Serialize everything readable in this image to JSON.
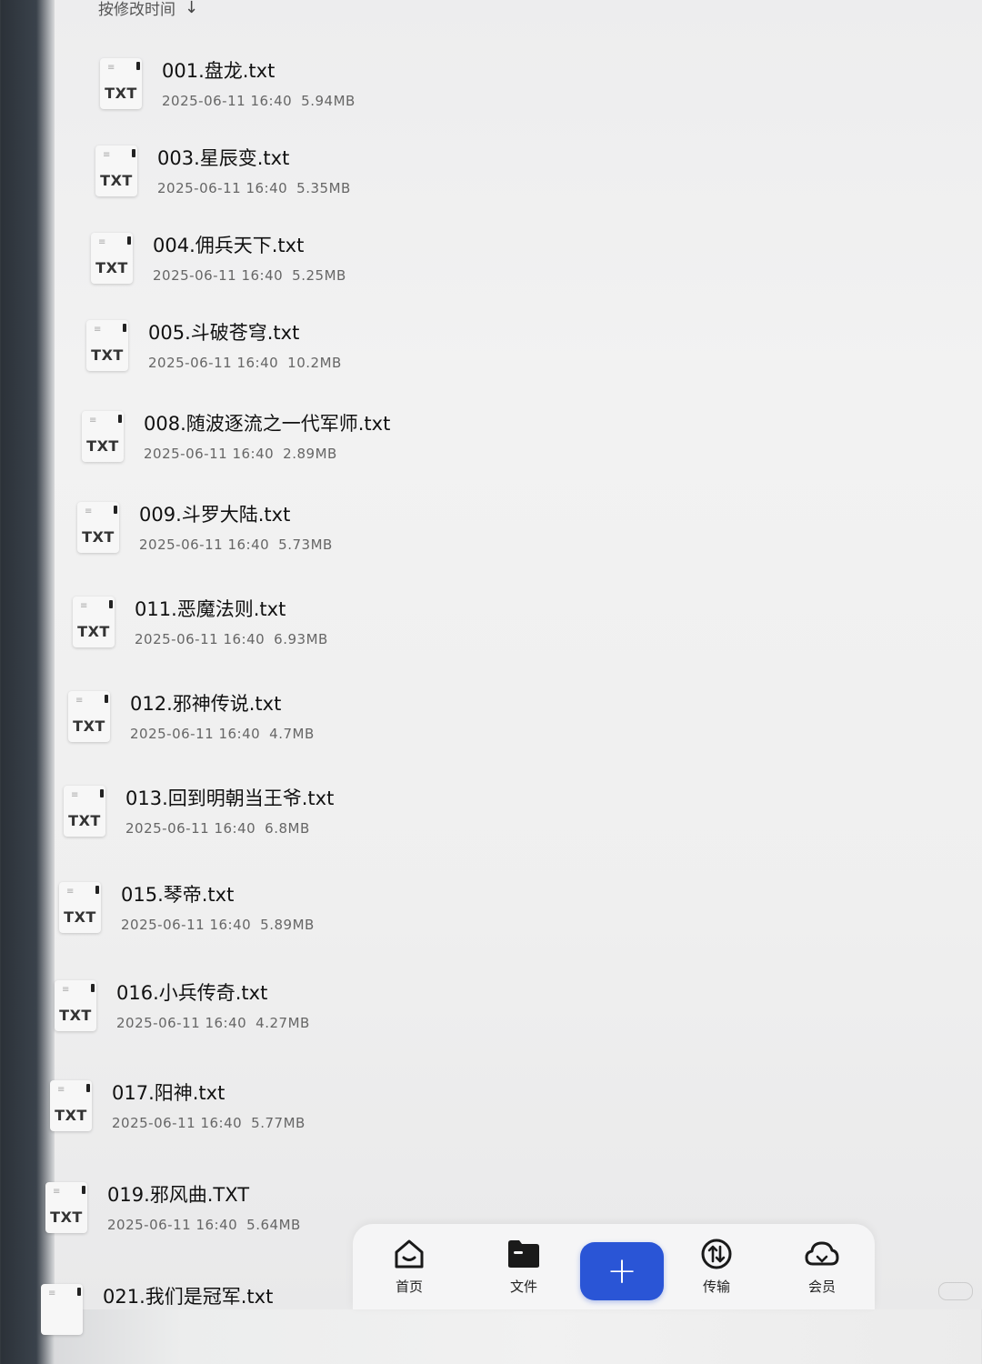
{
  "sort": {
    "label": "按修改时间",
    "arrow": "↓"
  },
  "files": [
    {
      "name": "001.盘龙.txt",
      "date": "2025-06-11 16:40",
      "size": "5.94MB",
      "ext": "TXT"
    },
    {
      "name": "003.星辰变.txt",
      "date": "2025-06-11 16:40",
      "size": "5.35MB",
      "ext": "TXT"
    },
    {
      "name": "004.佣兵天下.txt",
      "date": "2025-06-11 16:40",
      "size": "5.25MB",
      "ext": "TXT"
    },
    {
      "name": "005.斗破苍穹.txt",
      "date": "2025-06-11 16:40",
      "size": "10.2MB",
      "ext": "TXT"
    },
    {
      "name": "008.随波逐流之一代军师.txt",
      "date": "2025-06-11 16:40",
      "size": "2.89MB",
      "ext": "TXT"
    },
    {
      "name": "009.斗罗大陆.txt",
      "date": "2025-06-11 16:40",
      "size": "5.73MB",
      "ext": "TXT"
    },
    {
      "name": "011.恶魔法则.txt",
      "date": "2025-06-11 16:40",
      "size": "6.93MB",
      "ext": "TXT"
    },
    {
      "name": "012.邪神传说.txt",
      "date": "2025-06-11 16:40",
      "size": "4.7MB",
      "ext": "TXT"
    },
    {
      "name": "013.回到明朝当王爷.txt",
      "date": "2025-06-11 16:40",
      "size": "6.8MB",
      "ext": "TXT"
    },
    {
      "name": "015.琴帝.txt",
      "date": "2025-06-11 16:40",
      "size": "5.89MB",
      "ext": "TXT"
    },
    {
      "name": "016.小兵传奇.txt",
      "date": "2025-06-11 16:40",
      "size": "4.27MB",
      "ext": "TXT"
    },
    {
      "name": "017.阳神.txt",
      "date": "2025-06-11 16:40",
      "size": "5.77MB",
      "ext": "TXT"
    },
    {
      "name": "019.邪风曲.TXT",
      "date": "2025-06-11 16:40",
      "size": "5.64MB",
      "ext": "TXT"
    },
    {
      "name": "021.我们是冠军.txt",
      "date": "",
      "size": "",
      "ext": ""
    }
  ],
  "tabbar": {
    "home": "首页",
    "files": "文件",
    "add": "+",
    "transfer": "传输",
    "member": "会员"
  },
  "colors": {
    "accent": "#2a55d6"
  }
}
